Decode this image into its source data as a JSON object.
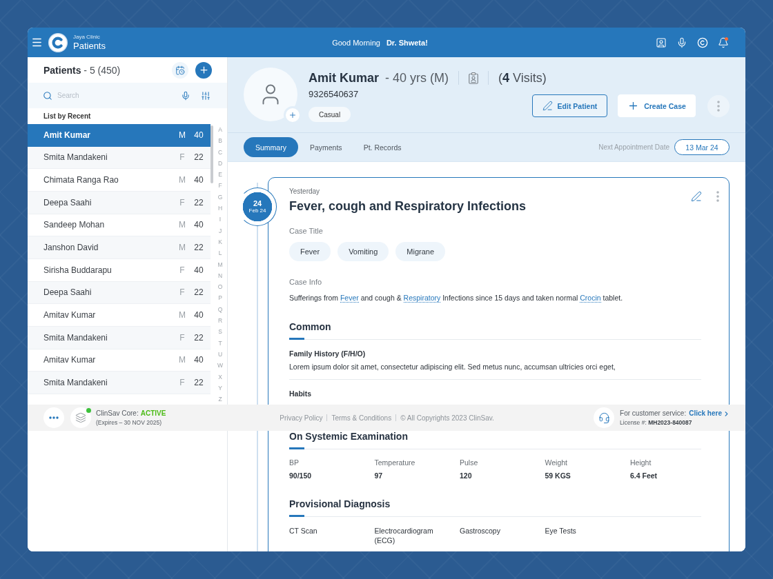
{
  "app_bar": {
    "clinic": "Jaya Clinic",
    "section": "Patients",
    "greeting": "Good Morning",
    "doctor": "Dr. Shweta!",
    "unread_notifications": true
  },
  "sidebar": {
    "title": "**Patients** - 5 (450)",
    "search": {
      "placeholder": "Search"
    },
    "list_heading": "List by Recent",
    "patients": [
      {
        "name": "Amit Kumar",
        "gender": "M",
        "age": "40",
        "selected": true
      },
      {
        "name": "Smita Mandakeni",
        "gender": "F",
        "age": "22",
        "selected": false
      },
      {
        "name": "Chimata Ranga Rao",
        "gender": "M",
        "age": "40",
        "selected": false
      },
      {
        "name": "Deepa Saahi",
        "gender": "F",
        "age": "22",
        "selected": false
      },
      {
        "name": "Sandeep Mohan",
        "gender": "M",
        "age": "40",
        "selected": false
      },
      {
        "name": "Janshon David",
        "gender": "M",
        "age": "22",
        "selected": false
      },
      {
        "name": "Sirisha Buddarapu",
        "gender": "F",
        "age": "40",
        "selected": false
      },
      {
        "name": "Deepa Saahi",
        "gender": "F",
        "age": "22",
        "selected": false
      },
      {
        "name": "Amitav Kumar",
        "gender": "M",
        "age": "40",
        "selected": false
      },
      {
        "name": "Smita Mandakeni",
        "gender": "F",
        "age": "22",
        "selected": false
      },
      {
        "name": "Amitav Kumar",
        "gender": "M",
        "age": "40",
        "selected": false
      },
      {
        "name": "Smita Mandakeni",
        "gender": "F",
        "age": "22",
        "selected": false
      }
    ],
    "index_letters": [
      "A",
      "B",
      "C",
      "D",
      "E",
      "F",
      "G",
      "H",
      "I",
      "J",
      "K",
      "L",
      "M",
      "N",
      "O",
      "P",
      "Q",
      "R",
      "S",
      "T",
      "U",
      "W",
      "X",
      "Y",
      "Z"
    ]
  },
  "patient": {
    "name": "Amit Kumar",
    "details": "- 40 yrs (M)",
    "visits": "(**4** Visits)",
    "phone": "9326540637",
    "tag": "Casual",
    "actions": [
      {
        "kind": "edit",
        "label": "Edit Patient"
      },
      {
        "kind": "create",
        "label": "Create Case"
      }
    ]
  },
  "tabs": [
    {
      "label": "Summary",
      "selected": true
    },
    {
      "label": "Payments",
      "selected": false
    },
    {
      "label": "Pt. Records",
      "selected": false
    }
  ],
  "next_appointment": {
    "label": "Next Appointment Date",
    "date": "13 Mar 24"
  },
  "case": {
    "day": "24",
    "month": "Feb 24",
    "when": "Yesterday",
    "title": "Fever, cough and Respiratory Infections",
    "case_title_label": "Case Title",
    "tags": [
      "Fever",
      "Vomiting",
      "Migrane"
    ],
    "case_info_label": "Case Info",
    "case_info": [
      {
        "kind": "text",
        "text": "Sufferings from "
      },
      {
        "kind": "link",
        "text": "Fever"
      },
      {
        "kind": "text",
        "text": " and cough & "
      },
      {
        "kind": "link",
        "text": "Respiratory"
      },
      {
        "kind": "text",
        "text": " Infections since 15 days and taken normal "
      },
      {
        "kind": "link",
        "text": "Crocin"
      },
      {
        "kind": "text",
        "text": " tablet."
      }
    ],
    "sections": [
      {
        "kind": "notes",
        "heading": "Common",
        "items": [
          {
            "title": "Family History (F/H/O)",
            "text": "Lorem ipsum dolor sit amet, consectetur adipiscing elit. Sed metus nunc, accumsan ultricies orci eget,"
          },
          {
            "title": "Habits"
          }
        ]
      },
      {
        "kind": "vitals",
        "heading": "On Systemic Examination",
        "fields": [
          {
            "label": "BP",
            "value": "90/150"
          },
          {
            "label": "Temperature",
            "value": "97"
          },
          {
            "label": "Pulse",
            "value": "120"
          },
          {
            "label": "Weight",
            "value": "59 KGS"
          },
          {
            "label": "Height",
            "value": "6.4 Feet"
          }
        ]
      },
      {
        "kind": "list",
        "heading": "Provisional Diagnosis",
        "items": [
          "CT Scan",
          "Electrocardiogram (ECG)",
          "Gastroscopy",
          "Eye Tests"
        ]
      }
    ]
  },
  "footer": {
    "plan": {
      "label": "ClinSav Core:",
      "status": "ACTIVE",
      "expiry": "(Expires – 30 NOV 2025)"
    },
    "links": [
      "Privacy Policy",
      "Terms & Conditions"
    ],
    "copyright": "© All Copyrights 2023 ClinSav.",
    "support": {
      "label": "For customer service:",
      "link": "Click here",
      "license": "License #: **MH2023-840087**"
    }
  }
}
